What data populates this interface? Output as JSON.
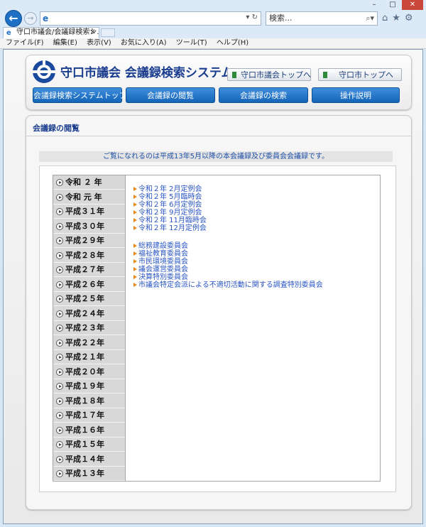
{
  "browser": {
    "url_text": "",
    "search_placeholder": "検索...",
    "tab_title": "守口市議会/会議録検索シ...",
    "menu": [
      "ファイル(F)",
      "編集(E)",
      "表示(V)",
      "お気に入り(A)",
      "ツール(T)",
      "ヘルプ(H)"
    ]
  },
  "header": {
    "site_title": "守口市議会 会議録検索システム",
    "top_buttons": [
      "守口市議会トップへ",
      "守口市トップへ"
    ],
    "nav": [
      "会議録検索システムトップ",
      "会議録の閲覧",
      "会議録の検索",
      "操作説明"
    ]
  },
  "main": {
    "title": "会議録の閲覧",
    "notice": "ご覧になれるのは平成13年5月以降の本会議録及び委員会会議録です。",
    "years": [
      "令和 ２ 年",
      "令和 元 年",
      "平成３１年",
      "平成３０年",
      "平成２９年",
      "平成２８年",
      "平成２７年",
      "平成２６年",
      "平成２５年",
      "平成２４年",
      "平成２３年",
      "平成２２年",
      "平成２１年",
      "平成２０年",
      "平成１９年",
      "平成１８年",
      "平成１７年",
      "平成１６年",
      "平成１５年",
      "平成１４年",
      "平成１３年"
    ],
    "plenary_links": [
      "令和２年 2月定例会",
      "令和２年 5月臨時会",
      "令和２年 6月定例会",
      "令和２年 9月定例会",
      "令和２年 11月臨時会",
      "令和２年 12月定例会"
    ],
    "committee_links": [
      "総務建設委員会",
      "福祉教育委員会",
      "市民環境委員会",
      "議会運営委員会",
      "決算特別委員会",
      "市議会特定会派による不適切活動に関する調査特別委員会"
    ]
  }
}
